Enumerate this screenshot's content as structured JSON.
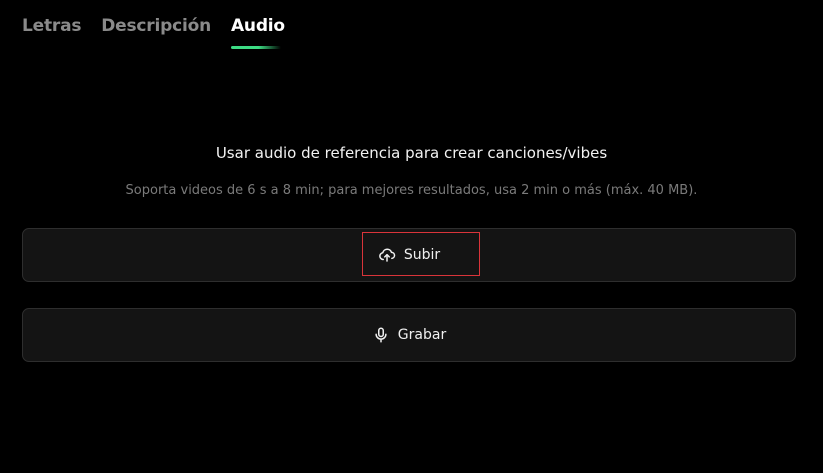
{
  "tabs": [
    {
      "label": "Letras",
      "active": false
    },
    {
      "label": "Descripción",
      "active": false
    },
    {
      "label": "Audio",
      "active": true
    }
  ],
  "audio": {
    "heading": "Usar audio de referencia para crear canciones/vibes",
    "subtext": "Soporta videos de 6 s a 8 min; para mejores resultados, usa 2 min o más (máx. 40 MB).",
    "upload_label": "Subir",
    "upload_icon": "cloud-upload-icon",
    "record_label": "Grabar",
    "record_icon": "microphone-icon"
  },
  "colors": {
    "background": "#000000",
    "accent": "#3ddc84",
    "button_bg": "#141414",
    "button_border": "#2e2e2e",
    "highlight": "#d9343a",
    "inactive_tab": "#8a8a8a"
  }
}
